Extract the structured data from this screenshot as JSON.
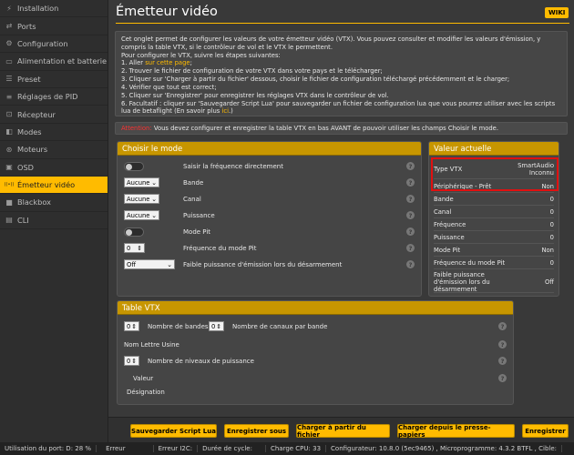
{
  "sidebar": {
    "items": [
      {
        "label": "Installation",
        "icon": "usb-icon",
        "glyph": "⚡"
      },
      {
        "label": "Ports",
        "icon": "ports-icon",
        "glyph": "⇄"
      },
      {
        "label": "Configuration",
        "icon": "gear-icon",
        "glyph": "⚙"
      },
      {
        "label": "Alimentation et batterie",
        "icon": "battery-icon",
        "glyph": "▭"
      },
      {
        "label": "Preset",
        "icon": "preset-icon",
        "glyph": "☰"
      },
      {
        "label": "Réglages de PID",
        "icon": "sliders-icon",
        "glyph": "≡"
      },
      {
        "label": "Récepteur",
        "icon": "receiver-icon",
        "glyph": "⊡"
      },
      {
        "label": "Modes",
        "icon": "modes-icon",
        "glyph": "◧"
      },
      {
        "label": "Moteurs",
        "icon": "motor-icon",
        "glyph": "⊛"
      },
      {
        "label": "OSD",
        "icon": "osd-icon",
        "glyph": "▣"
      },
      {
        "label": "Émetteur vidéo",
        "icon": "vtx-icon",
        "glyph": "((•))",
        "active": true
      },
      {
        "label": "Blackbox",
        "icon": "blackbox-icon",
        "glyph": "■"
      },
      {
        "label": "CLI",
        "icon": "cli-icon",
        "glyph": "▤"
      }
    ]
  },
  "header": {
    "title": "Émetteur vidéo",
    "wiki": "WIKI"
  },
  "intro": {
    "p1": "Cet onglet permet de configurer les valeurs de votre émetteur vidéo (VTX). Vous pouvez consulter et modifier les valeurs d'émission, y compris la table VTX, si le contrôleur de vol et le VTX le permettent.",
    "p2": "Pour configurer le VTX, suivre les étapes suivantes:",
    "s1a": "1. Aller ",
    "s1link": "sur cette page",
    "s1b": ";",
    "s2": "2. Trouver le fichier de configuration de votre VTX dans votre pays et le télécharger;",
    "s3": "3. Cliquer sur 'Charger à partir du fichier' dessous, choisir le fichier de configuration téléchargé précédemment et le charger;",
    "s4": "4. Vérifier que tout est correct;",
    "s5": "5. Cliquer sur 'Enregistrer' pour enregistrer les réglages VTX dans le contrôleur de vol.",
    "s6a": "6. Facultatif : cliquer sur 'Sauvegarder Script Lua' pour sauvegarder un fichier de configuration lua que vous pourrez utiliser avec les scripts lua de betaflight (En savoir plus ",
    "s6link": "ici",
    "s6b": ".)"
  },
  "warning": {
    "label": "Attention:",
    "text": " Vous devez configurer et enregistrer la table VTX en bas AVANT de pouvoir utiliser les champs Choisir le mode."
  },
  "mode": {
    "title": "Choisir le mode",
    "rows": {
      "freq_direct": "Saisir la fréquence directement",
      "band": "Bande",
      "channel": "Canal",
      "power": "Puissance",
      "pit": "Mode Pit",
      "pit_freq": "Fréquence du mode Pit",
      "low_power": "Faible puissance d'émission lors du désarmement"
    },
    "band_value": "Aucune",
    "channel_value": "Aucune",
    "power_value": "Aucune",
    "pit_freq_value": "0",
    "low_power_value": "Off"
  },
  "current": {
    "title": "Valeur actuelle",
    "rows": [
      {
        "k": "Type VTX",
        "v": "SmartAudio Inconnu"
      },
      {
        "k": "Périphérique - Prêt",
        "v": "Non"
      },
      {
        "k": "Bande",
        "v": "0"
      },
      {
        "k": "Canal",
        "v": "0"
      },
      {
        "k": "Fréquence",
        "v": "0"
      },
      {
        "k": "Puissance",
        "v": "0"
      },
      {
        "k": "Mode Pit",
        "v": "Non"
      },
      {
        "k": "Fréquence du mode Pit",
        "v": "0"
      },
      {
        "k": "Faible puissance d'émission lors du désarmement",
        "v": "Off"
      }
    ]
  },
  "vtx_table": {
    "title": "Table VTX",
    "bands_label": "Nombre de bandes",
    "bands_value": "0",
    "channels_label": "Nombre de canaux par bande",
    "channels_value": "0",
    "factory_label": "Nom Lettre Usine",
    "power_levels_label": "Nombre de niveaux de puissance",
    "power_levels_value": "0",
    "value_label": "Valeur",
    "designation_label": "Désignation"
  },
  "buttons": {
    "save_lua": "Sauvegarder Script Lua",
    "save_as": "Enregistrer sous",
    "load_file": "Charger à partir du fichier",
    "load_clipboard": "Charger depuis le presse-papiers",
    "save": "Enregistrer"
  },
  "status": {
    "port_usage": "Utilisation du port: D: 28 %",
    "error": "Erreur",
    "i2c_error": "Erreur I2C:",
    "cycle": "Durée de cycle:",
    "cpu": "Charge CPU: 33",
    "configurator": "Configurateur: 10.8.0 (5ec9465) , Microprogramme: 4.3.2 BTFL , Cible:"
  },
  "colors": {
    "accent": "#ffbb00",
    "panel_header": "#c79600",
    "highlight": "#e01010"
  }
}
